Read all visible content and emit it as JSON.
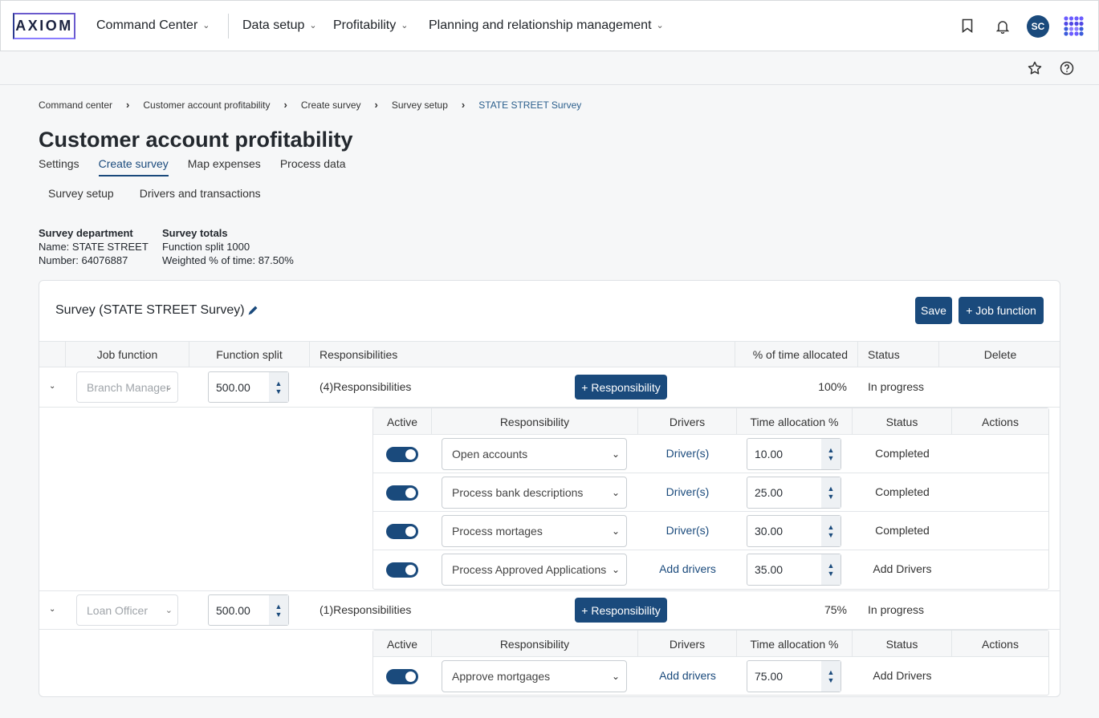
{
  "app": {
    "logo": "AXIOM",
    "nav": [
      {
        "label": "Command Center"
      },
      {
        "label": "Data setup"
      },
      {
        "label": "Profitability"
      },
      {
        "label": "Planning and relationship management"
      }
    ],
    "avatar_initials": "SC",
    "accent_color": "#1a4a7c"
  },
  "breadcrumb": [
    "Command center",
    "Customer account profitability",
    "Create survey",
    "Survey setup",
    "STATE STREET Survey"
  ],
  "page_title": "Customer account profitability",
  "tabs": [
    "Settings",
    "Create survey",
    "Map expenses",
    "Process data"
  ],
  "active_tab": "Create survey",
  "subtabs": [
    "Survey setup",
    "Drivers and transactions"
  ],
  "survey_department": {
    "heading": "Survey department",
    "name": "Name: STATE STREET",
    "number": "Number: 64076887"
  },
  "survey_totals": {
    "heading": "Survey totals",
    "function_split": "Function split 1000",
    "weighted": "Weighted % of time: 87.50%"
  },
  "card": {
    "title": "Survey (STATE STREET Survey)",
    "save_label": "Save",
    "add_job_function_label": "+ Job function"
  },
  "table": {
    "headers": {
      "job_function": "Job function",
      "function_split": "Function split",
      "responsibilities": "Responsibilities",
      "time_allocated": "% of time allocated",
      "status": "Status",
      "delete": "Delete"
    },
    "add_responsibility_label": "+ Responsibility",
    "inner_headers": {
      "active": "Active",
      "responsibility": "Responsibility",
      "drivers": "Drivers",
      "time_allocation": "Time allocation %",
      "status": "Status",
      "actions": "Actions"
    },
    "rows": [
      {
        "job_function": "Branch Manager",
        "function_split": "500.00",
        "responsibilities": "(4)Responsibilities",
        "time_allocated": "100%",
        "status": "In progress",
        "items": [
          {
            "responsibility": "Open accounts",
            "drivers": "Driver(s)",
            "time": "10.00",
            "status": "Completed"
          },
          {
            "responsibility": "Process bank descriptions",
            "drivers": "Driver(s)",
            "time": "25.00",
            "status": "Completed"
          },
          {
            "responsibility": "Process mortages",
            "drivers": "Driver(s)",
            "time": "30.00",
            "status": "Completed"
          },
          {
            "responsibility": "Process Approved Applications",
            "drivers": "Add drivers",
            "time": "35.00",
            "status": "Add Drivers"
          }
        ]
      },
      {
        "job_function": "Loan Officer",
        "function_split": "500.00",
        "responsibilities": "(1)Responsibilities",
        "time_allocated": "75%",
        "status": "In progress",
        "items": [
          {
            "responsibility": "Approve mortgages",
            "drivers": "Add drivers",
            "time": "75.00",
            "status": "Add Drivers"
          }
        ]
      }
    ]
  }
}
